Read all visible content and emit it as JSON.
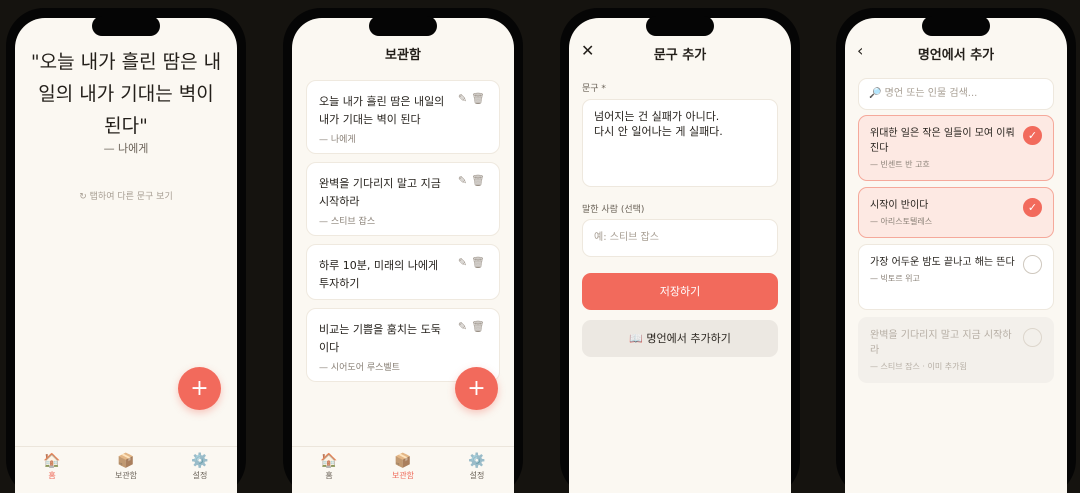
{
  "home": {
    "quote": "\"오늘 내가 흘린 땀은 내일의 내가 기대는 벽이 된다\"",
    "author": "— 나에게",
    "hint": "↻ 탭하여 다른 문구 보기"
  },
  "tabs": [
    {
      "label": "홈",
      "icon": "🏠"
    },
    {
      "label": "보관함",
      "icon": "📦"
    },
    {
      "label": "설정",
      "icon": "⚙️"
    }
  ],
  "fab_label": "+",
  "saved": {
    "title": "보관함",
    "items": [
      {
        "text": "오늘 내가 흘린 땀은 내일의 내가 기대는 벽이 된다",
        "author": "— 나에게"
      },
      {
        "text": "완벽을 기다리지 말고 지금 시작하라",
        "author": "— 스티브 잡스"
      },
      {
        "text": "하루 10분, 미래의 나에게 투자하기",
        "author": ""
      },
      {
        "text": "비교는 기쁨을 훔치는 도둑이다",
        "author": "— 시어도어 루스벨트"
      }
    ],
    "edit_icon": "✎",
    "delete_icon": "🗑"
  },
  "add": {
    "title": "문구 추가",
    "close_icon": "✕",
    "phrase_label": "문구 *",
    "phrase_value": "넘어지는 건 실패가 아니다.\n다시 안 일어나는 게 실패다.",
    "author_label": "말한 사람 (선택)",
    "author_placeholder": "예: 스티브 잡스",
    "save_label": "저장하기",
    "famous_label": "📖 명언에서 추가하기"
  },
  "famous": {
    "title": "명언에서 추가",
    "back_icon": "‹",
    "search_placeholder": "🔎 명언 또는 인물 검색...",
    "items": [
      {
        "text": "위대한 일은 작은 일들이 모여 이뤄진다",
        "author": "— 빈센트 반 고흐",
        "state": "selected"
      },
      {
        "text": "시작이 반이다",
        "author": "— 아리스토텔레스",
        "state": "selected"
      },
      {
        "text": "가장 어두운 밤도 끝나고 해는 뜬다",
        "author": "— 빅토르 위고",
        "state": "unselected"
      },
      {
        "text": "완벽을 기다리지 말고 지금 시작하라",
        "author": "— 스티브 잡스 · 이미 추가됨",
        "state": "disabled"
      }
    ],
    "check_mark": "✓"
  }
}
